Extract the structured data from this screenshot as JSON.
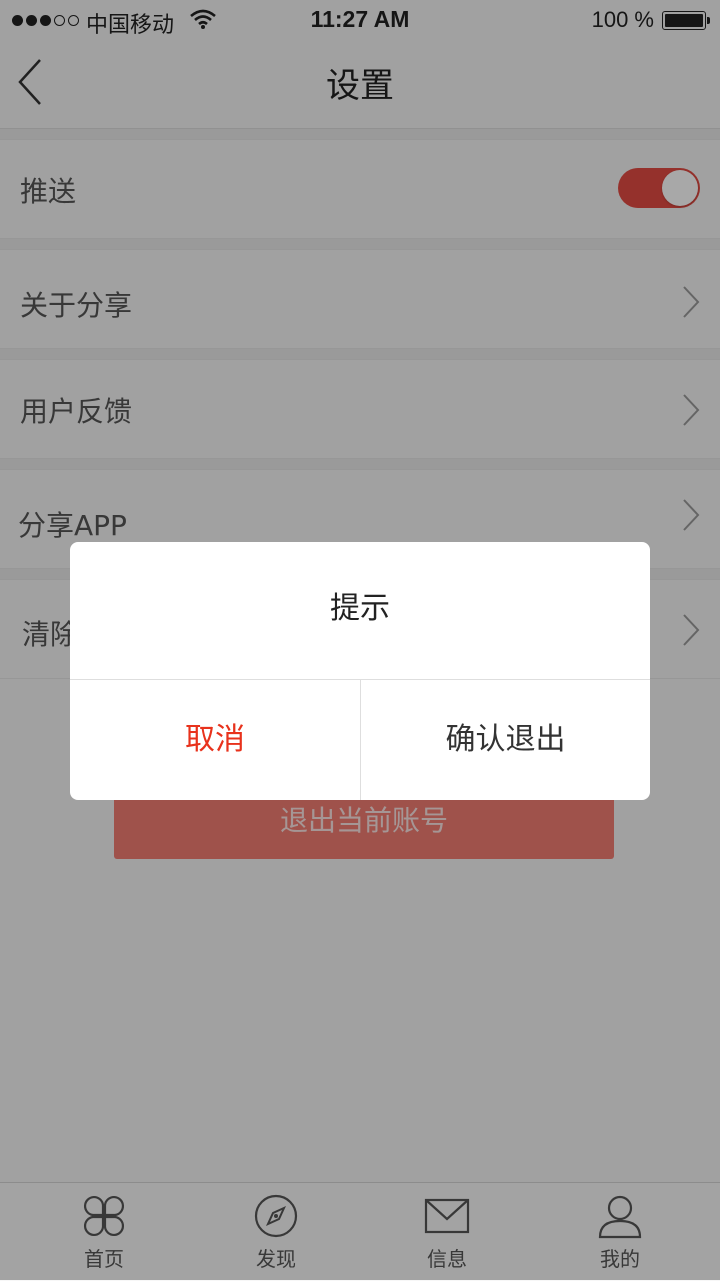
{
  "status_bar": {
    "carrier": "中国移动",
    "time": "11:27 AM",
    "battery": "100 %"
  },
  "nav": {
    "title": "设置"
  },
  "settings": {
    "push": {
      "label": "推送",
      "enabled": true
    },
    "about": {
      "label": "关于分享"
    },
    "feedback": {
      "label": "用户反馈"
    },
    "share_app": {
      "label": "分享APP"
    },
    "clear_cache": {
      "label": "清除缓存"
    }
  },
  "logout_button": "退出当前账号",
  "tabs": [
    {
      "label": "首页",
      "icon": "clover-icon"
    },
    {
      "label": "发现",
      "icon": "compass-icon"
    },
    {
      "label": "信息",
      "icon": "mail-icon"
    },
    {
      "label": "我的",
      "icon": "user-icon"
    }
  ],
  "dialog": {
    "title": "提示",
    "cancel": "取消",
    "confirm": "确认退出"
  },
  "colors": {
    "accent": "#e34b43",
    "cancel": "#e8321c",
    "background": "#f4f4f4"
  }
}
